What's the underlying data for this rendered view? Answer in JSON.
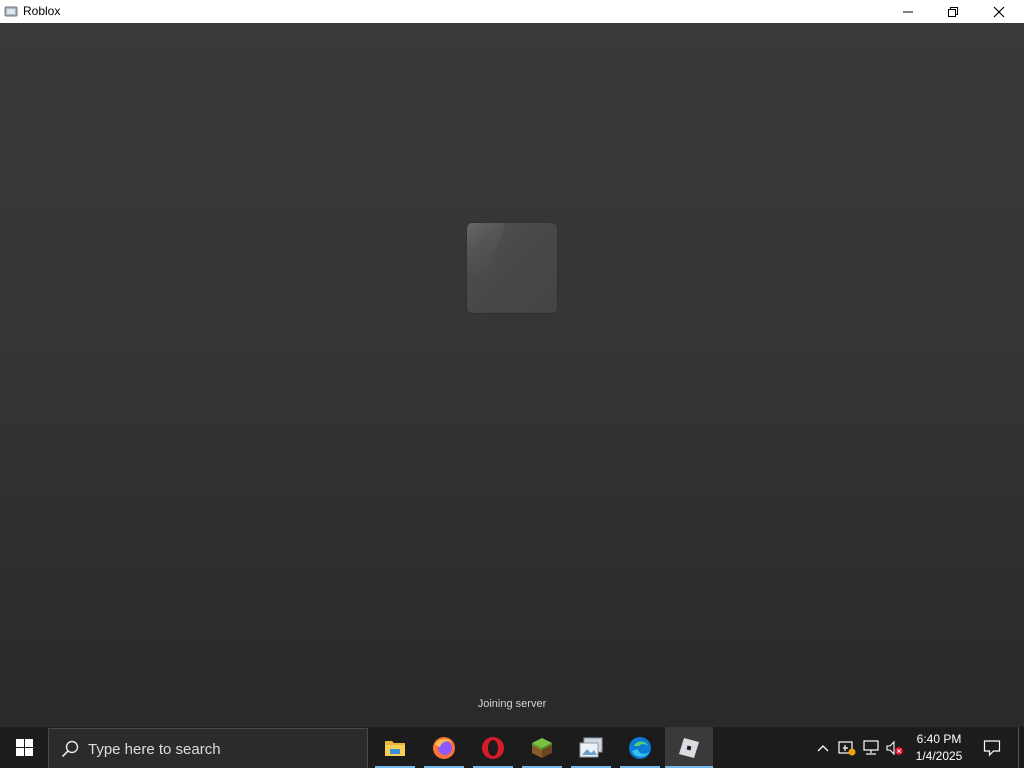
{
  "window": {
    "title": "Roblox",
    "minimize_icon": "minimize-icon",
    "maximize_icon": "restore-icon",
    "close_icon": "close-icon"
  },
  "game": {
    "status_text": "Joining server",
    "loading_icon": "roblox-loading-tile"
  },
  "taskbar": {
    "start_icon": "windows-logo-icon",
    "search": {
      "placeholder": "Type here to search",
      "icon": "search-icon"
    },
    "apps": [
      {
        "name": "File Explorer",
        "icon": "folder-icon",
        "active": false
      },
      {
        "name": "Firefox",
        "icon": "firefox-icon",
        "active": false
      },
      {
        "name": "Opera",
        "icon": "opera-icon",
        "active": false
      },
      {
        "name": "Minecraft",
        "icon": "minecraft-grass-block-icon",
        "active": false
      },
      {
        "name": "Photos",
        "icon": "gallery-icon",
        "active": false
      },
      {
        "name": "Microsoft Edge",
        "icon": "edge-icon",
        "active": false
      },
      {
        "name": "Roblox",
        "icon": "roblox-icon",
        "active": true
      }
    ],
    "tray": {
      "icons": [
        "chevron-up-icon",
        "security-warning-icon",
        "network-icon",
        "volume-muted-icon"
      ]
    },
    "clock": {
      "time": "6:40 PM",
      "date": "1/4/2025"
    },
    "notification_icon": "notification-icon"
  },
  "colors": {
    "accent_underline": "#76b9ed",
    "taskbar": "#1c1c1c",
    "game_background": "#353535"
  }
}
